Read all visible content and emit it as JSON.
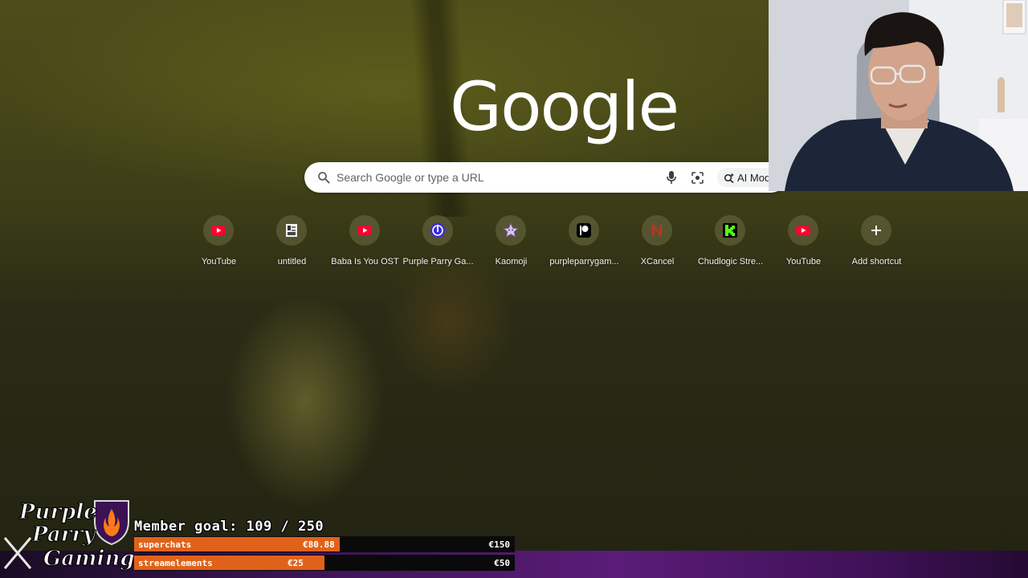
{
  "logo_text": "Google",
  "search": {
    "placeholder": "Search Google or type a URL",
    "ai_mode_label": "AI Mode"
  },
  "shortcuts": [
    {
      "label": "YouTube",
      "icon": "youtube-icon"
    },
    {
      "label": "untitled",
      "icon": "page-icon"
    },
    {
      "label": "Baba Is You OST",
      "icon": "youtube-icon"
    },
    {
      "label": "Purple Parry Ga...",
      "icon": "purple-parry-icon"
    },
    {
      "label": "Kaomoji",
      "icon": "star-icon"
    },
    {
      "label": "purpleparrygam...",
      "icon": "patreon-icon"
    },
    {
      "label": "XCancel",
      "icon": "nitter-icon"
    },
    {
      "label": "Chudlogic Stre...",
      "icon": "kick-icon"
    },
    {
      "label": "YouTube",
      "icon": "youtube-icon"
    },
    {
      "label": "Add shortcut",
      "icon": "plus-icon"
    }
  ],
  "overlay": {
    "channel_logo_text": "Purple Parry Gaming",
    "member_goal": "Member goal: 109 / 250",
    "goals": [
      {
        "name": "superchats",
        "current": "€80.88",
        "target": "€150",
        "progress": 0.54
      },
      {
        "name": "streamelements",
        "current": "€25",
        "target": "€50",
        "progress": 0.5
      }
    ]
  },
  "colors": {
    "goal_fill": "#e0621a",
    "youtube_red": "#ff0033",
    "kick_green": "#53fc18",
    "brand_purple": "#5a1c78"
  }
}
